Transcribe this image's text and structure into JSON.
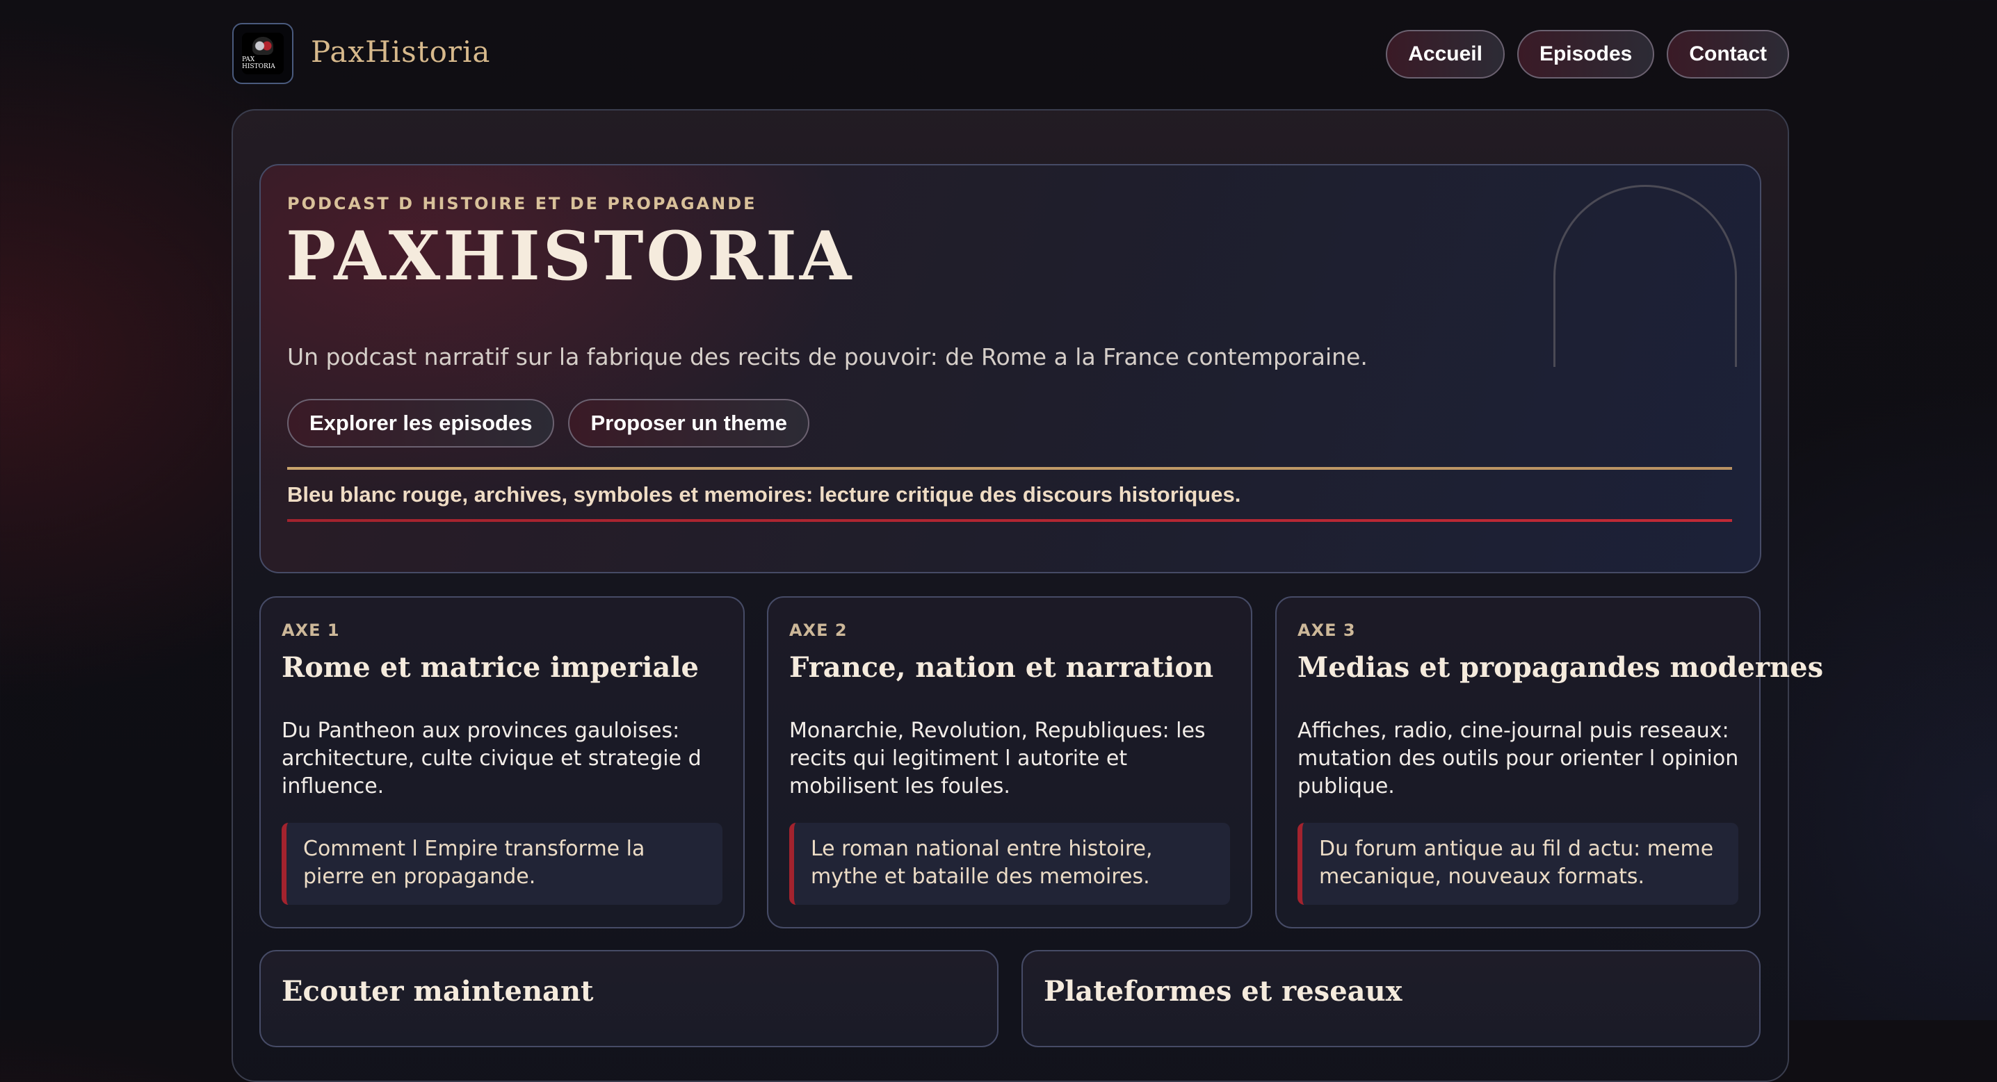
{
  "header": {
    "logo_text": "PAX HISTORIA",
    "brand": "PaxHistoria",
    "nav": [
      {
        "label": "Accueil"
      },
      {
        "label": "Episodes"
      },
      {
        "label": "Contact"
      }
    ]
  },
  "hero": {
    "kicker": "PODCAST D HISTOIRE ET DE PROPAGANDE",
    "title": "PAXHISTORIA",
    "subtitle": "Un podcast narratif sur la fabrique des recits de pouvoir: de Rome a la France contemporaine.",
    "actions": [
      {
        "label": "Explorer les episodes"
      },
      {
        "label": "Proposer un theme"
      }
    ],
    "tagline": "Bleu blanc rouge, archives, symboles et memoires: lecture critique des discours historiques."
  },
  "axes": [
    {
      "label": "AXE 1",
      "title": "Rome et matrice imperiale",
      "text": "Du Pantheon aux provinces gauloises: architecture, culte civique et strategie d influence.",
      "quote": "Comment l Empire transforme la pierre en propagande."
    },
    {
      "label": "AXE 2",
      "title": "France, nation et narration",
      "text": "Monarchie, Revolution, Republiques: les recits qui legitiment l autorite et mobilisent les foules.",
      "quote": "Le roman national entre histoire, mythe et bataille des memoires."
    },
    {
      "label": "AXE 3",
      "title": "Medias et propagandes modernes",
      "text": "Affiches, radio, cine-journal puis reseaux: mutation des outils pour orienter l opinion publique.",
      "quote": "Du forum antique au fil d actu: meme mecanique, nouveaux formats."
    }
  ],
  "bottom": {
    "listen_title": "Ecouter maintenant",
    "platforms_title": "Plateformes et reseaux"
  },
  "colors": {
    "accent_gold": "#d7b98c",
    "accent_red": "#a3232e",
    "background": "#100e13"
  }
}
